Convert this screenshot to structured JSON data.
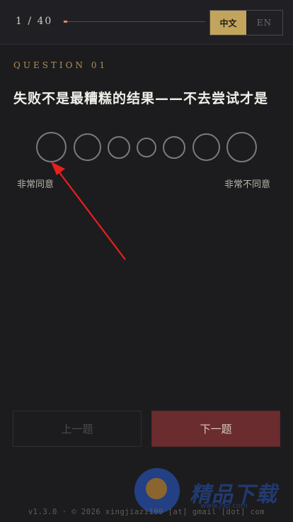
{
  "header": {
    "progress_text": "1 / 40",
    "progress_fraction": 0.025,
    "lang_zh": "中文",
    "lang_en": "EN",
    "active_lang": "zh"
  },
  "question": {
    "number_label": "QUESTION 01",
    "text": "失败不是最糟糕的结果——不去尝试才是"
  },
  "scale": {
    "left_label": "非常同意",
    "right_label": "非常不同意",
    "options_count": 7,
    "selected": null
  },
  "nav": {
    "prev_label": "上一题",
    "next_label": "下一题"
  },
  "footer": {
    "text": "v1.3.0 · © 2026 xingjiazi199 [at] gmail [dot] com"
  },
  "watermark": {
    "text": "精品下载",
    "url": "www.j9p.com"
  },
  "colors": {
    "accent_gold": "#c2a45c",
    "next_button": "#6a2c2e",
    "annotation_arrow": "#e8201c"
  }
}
